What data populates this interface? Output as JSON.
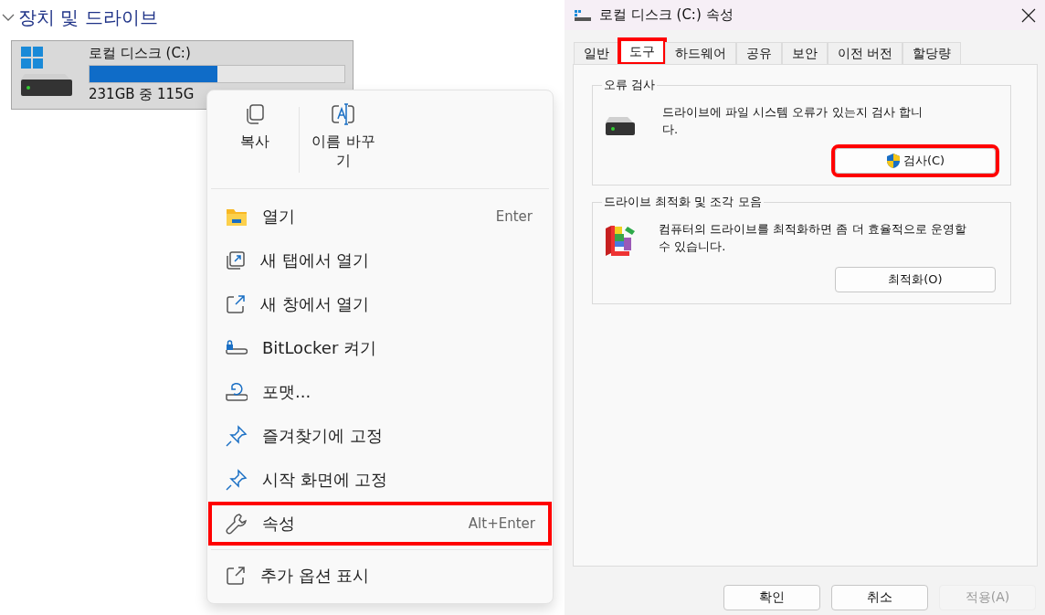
{
  "explorer": {
    "section": {
      "title": "장치 및 드라이브",
      "expanded": true
    },
    "drive": {
      "name": "로컬 디스크 (C:)",
      "level": 0.5,
      "caption": "231GB 중 115G"
    },
    "context_menu": {
      "quick_actions": [
        {
          "label": "복사"
        },
        {
          "label": "이름 바꾸기"
        }
      ],
      "items": [
        {
          "label": "열기",
          "shortcut": "Enter",
          "highlighted": false
        },
        {
          "label": "새 탭에서 열기",
          "highlighted": false
        },
        {
          "label": "새 창에서 열기",
          "highlighted": false
        },
        {
          "label": "BitLocker 켜기",
          "highlighted": false
        },
        {
          "label": "포맷...",
          "highlighted": false
        },
        {
          "label": "즐겨찾기에 고정",
          "highlighted": false
        },
        {
          "label": "시작 화면에 고정",
          "highlighted": false
        },
        {
          "label": "속성",
          "shortcut": "Alt+Enter",
          "highlighted": true
        }
      ],
      "footer_item": {
        "label": "추가 옵션 표시"
      }
    }
  },
  "dialog": {
    "title": "로컬 디스크 (C:) 속성",
    "tabs": [
      {
        "label": "일반",
        "selected": false,
        "highlighted": false
      },
      {
        "label": "도구",
        "selected": true,
        "highlighted": true
      },
      {
        "label": "하드웨어",
        "selected": false,
        "highlighted": false
      },
      {
        "label": "공유",
        "selected": false,
        "highlighted": false
      },
      {
        "label": "보안",
        "selected": false,
        "highlighted": false
      },
      {
        "label": "이전 버전",
        "selected": false,
        "highlighted": false
      },
      {
        "label": "할당량",
        "selected": false,
        "highlighted": false
      }
    ],
    "groups": [
      {
        "kind": "check",
        "title": "오류 검사",
        "text": "드라이브에 파일 시스템 오류가 있는지 검사 합니다.",
        "button": {
          "label": "검사(C)",
          "highlighted": true,
          "shield": true
        }
      },
      {
        "kind": "optimize",
        "title": "드라이브 최적화 및 조각 모음",
        "text": "컴퓨터의 드라이브를 최적화하면 좀 더 효율적으로 운영할 수 있습니다.",
        "button": {
          "label": "최적화(O)",
          "highlighted": false,
          "shield": false
        }
      }
    ],
    "buttons": [
      {
        "label": "확인",
        "disabled": false
      },
      {
        "label": "취소",
        "disabled": false
      },
      {
        "label": "적용(A)",
        "disabled": true
      }
    ]
  }
}
